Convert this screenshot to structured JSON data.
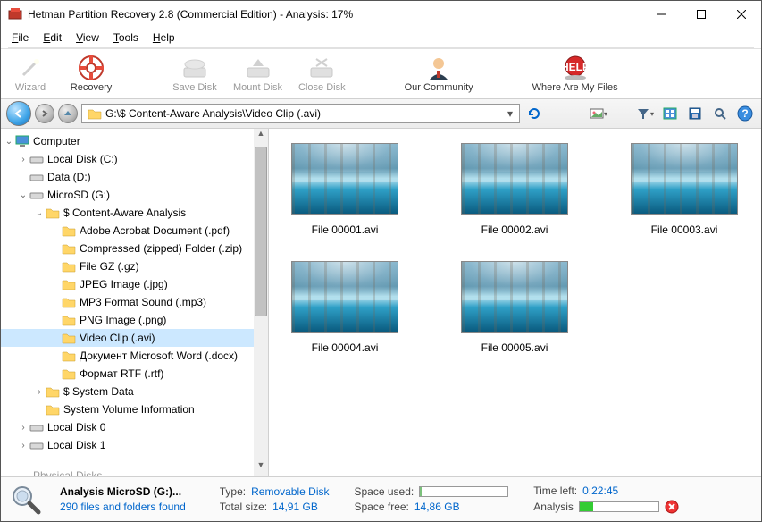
{
  "window": {
    "title": "Hetman Partition Recovery 2.8 (Commercial Edition) - Analysis: 17%"
  },
  "menu": {
    "file": "File",
    "edit": "Edit",
    "view": "View",
    "tools": "Tools",
    "help": "Help"
  },
  "toolbar": {
    "wizard": "Wizard",
    "recovery": "Recovery",
    "save_disk": "Save Disk",
    "mount_disk": "Mount Disk",
    "close_disk": "Close Disk",
    "community": "Our Community",
    "where_files": "Where Are My Files"
  },
  "address": {
    "path": "G:\\$ Content-Aware Analysis\\Video Clip (.avi)"
  },
  "tree": {
    "root": "Computer",
    "local_c": "Local Disk (C:)",
    "data_d": "Data (D:)",
    "microsd": "MicroSD (G:)",
    "caa": "$ Content-Aware Analysis",
    "pdf": "Adobe Acrobat Document (.pdf)",
    "zip": "Compressed (zipped) Folder (.zip)",
    "gz": "File GZ (.gz)",
    "jpeg": "JPEG Image (.jpg)",
    "mp3": "MP3 Format Sound (.mp3)",
    "png": "PNG Image (.png)",
    "avi": "Video Clip (.avi)",
    "docx": "Документ Microsoft Word (.docx)",
    "rtf": "Формат RTF (.rtf)",
    "sysdata": "$ System Data",
    "svi": "System Volume Information",
    "ld0": "Local Disk 0",
    "ld1": "Local Disk 1",
    "phys": "Physical Disks"
  },
  "files": {
    "f1": "File 00001.avi",
    "f2": "File 00002.avi",
    "f3": "File 00003.avi",
    "f4": "File 00004.avi",
    "f5": "File 00005.avi"
  },
  "status": {
    "analysis_title": "Analysis MicroSD (G:)...",
    "files_found": "290 files and folders found",
    "type_label": "Type:",
    "type_value": "Removable Disk",
    "total_label": "Total size:",
    "total_value": "14,91 GB",
    "used_label": "Space used:",
    "free_label": "Space free:",
    "free_value": "14,86 GB",
    "timeleft_label": "Time left:",
    "timeleft_value": "0:22:45",
    "analysis_label": "Analysis"
  }
}
